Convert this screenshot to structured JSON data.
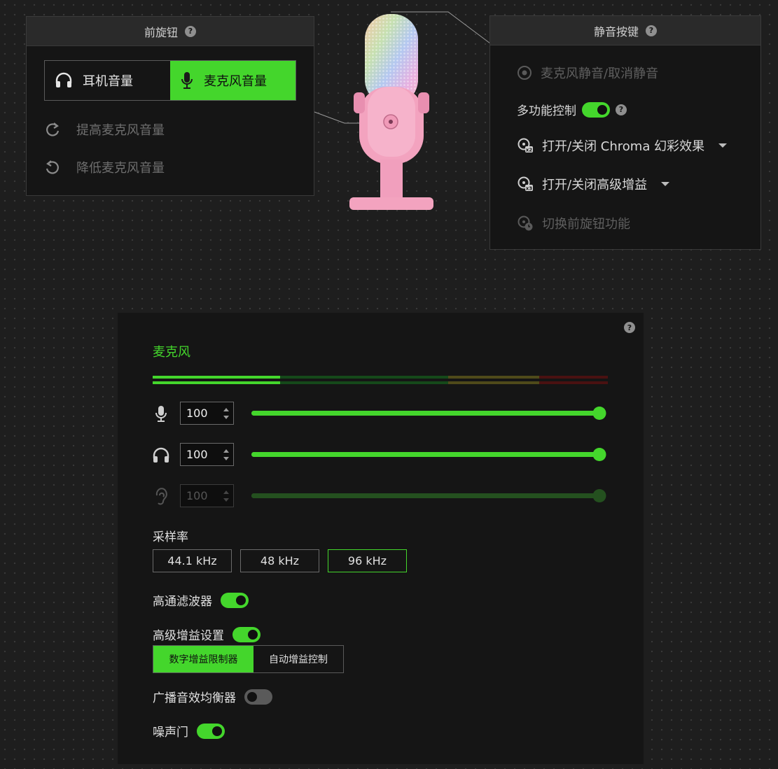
{
  "front_knob": {
    "title": "前旋钮",
    "modes": [
      "耳机音量",
      "麦克风音量"
    ],
    "active_mode": "麦克风音量",
    "actions": [
      "提高麦克风音量",
      "降低麦克风音量"
    ]
  },
  "mute_button": {
    "title": "静音按键",
    "mute_toggle_label": "麦克风静音/取消静音",
    "multifunction_label": "多功能控制",
    "multifunction_enabled": true,
    "chroma_label": "打开/关闭 Chroma 幻彩效果",
    "gain_label": "打开/关闭高级增益",
    "switch_knob_label": "切换前旋钮功能"
  },
  "microphone": {
    "section_title": "麦克风",
    "mic_volume": "100",
    "headphone_volume": "100",
    "sidetone_volume": "100",
    "mic_volume_level": 1.0,
    "headphone_volume_level": 1.0,
    "sidetone_volume_level": 1.0,
    "sample_rate_label": "采样率",
    "sample_rates": [
      "44.1 kHz",
      "48 kHz",
      "96 kHz"
    ],
    "selected_sample_rate": "96 kHz",
    "high_pass_label": "高通滤波器",
    "high_pass_enabled": true,
    "advanced_gain_label": "高级增益设置",
    "advanced_gain_enabled": true,
    "gain_modes": [
      "数字增益限制器",
      "自动增益控制"
    ],
    "selected_gain_mode": "数字增益限制器",
    "eq_label": "广播音效均衡器",
    "eq_enabled": false,
    "noise_gate_label": "噪声门",
    "noise_gate_enabled": true
  },
  "colors": {
    "accent": "#44d62c",
    "panel": "#151515",
    "background": "#1e1e1e",
    "mic_body": "#f3a3bf"
  }
}
